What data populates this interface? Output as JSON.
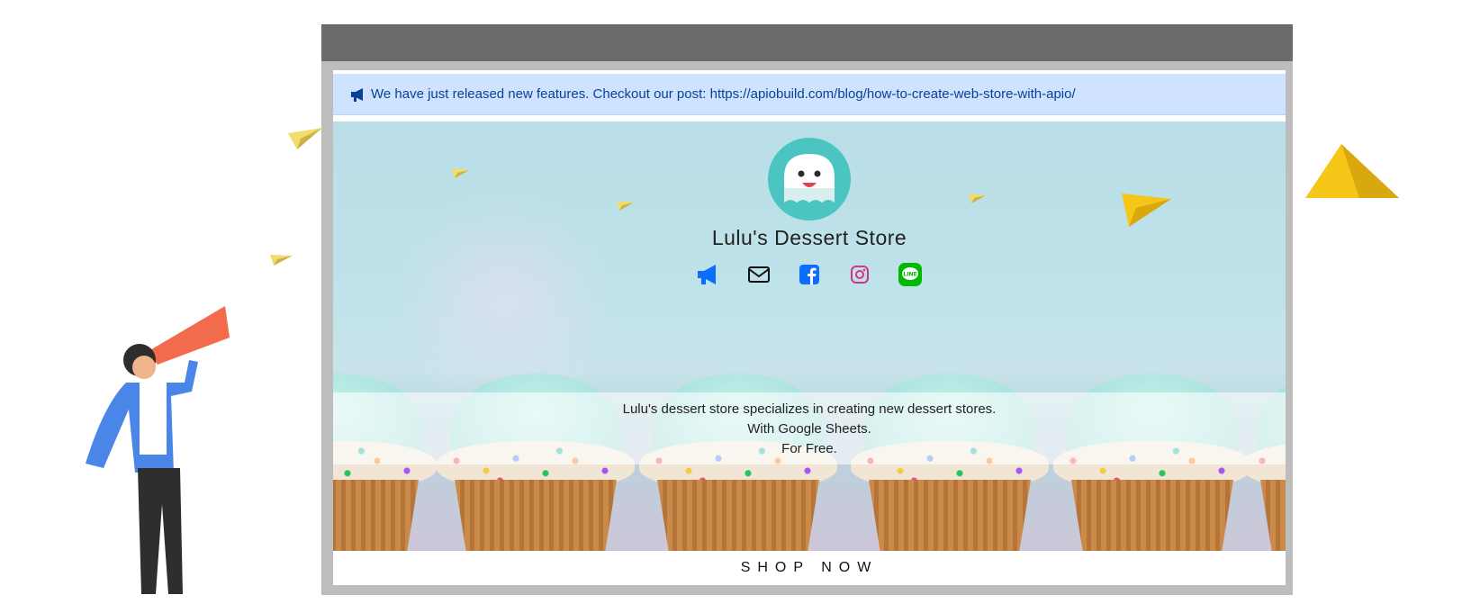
{
  "announcement": {
    "text": "We have just released new features. Checkout our post: https://apiobuild.com/blog/how-to-create-web-store-with-apio/"
  },
  "store": {
    "name": "Lulu's Dessert Store",
    "description_lines": [
      "Lulu's dessert store specializes in creating new dessert stores.",
      "With Google Sheets.",
      "For Free."
    ]
  },
  "socials": [
    {
      "icon": "megaphone-icon",
      "color": "#0d6efd"
    },
    {
      "icon": "envelope-icon",
      "color": "#111111"
    },
    {
      "icon": "facebook-icon",
      "color": "#0d6efd"
    },
    {
      "icon": "instagram-icon",
      "color": "#d63384"
    },
    {
      "icon": "line-icon",
      "color": "#00b900"
    }
  ],
  "cta": {
    "label": "SHOP NOW"
  },
  "colors": {
    "announcement_bg": "#cfe2ff",
    "announcement_text": "#084298",
    "logo_bg": "#4bc4c2",
    "browser_bar": "#6b6b6b",
    "browser_frame": "#bdbdbd"
  }
}
